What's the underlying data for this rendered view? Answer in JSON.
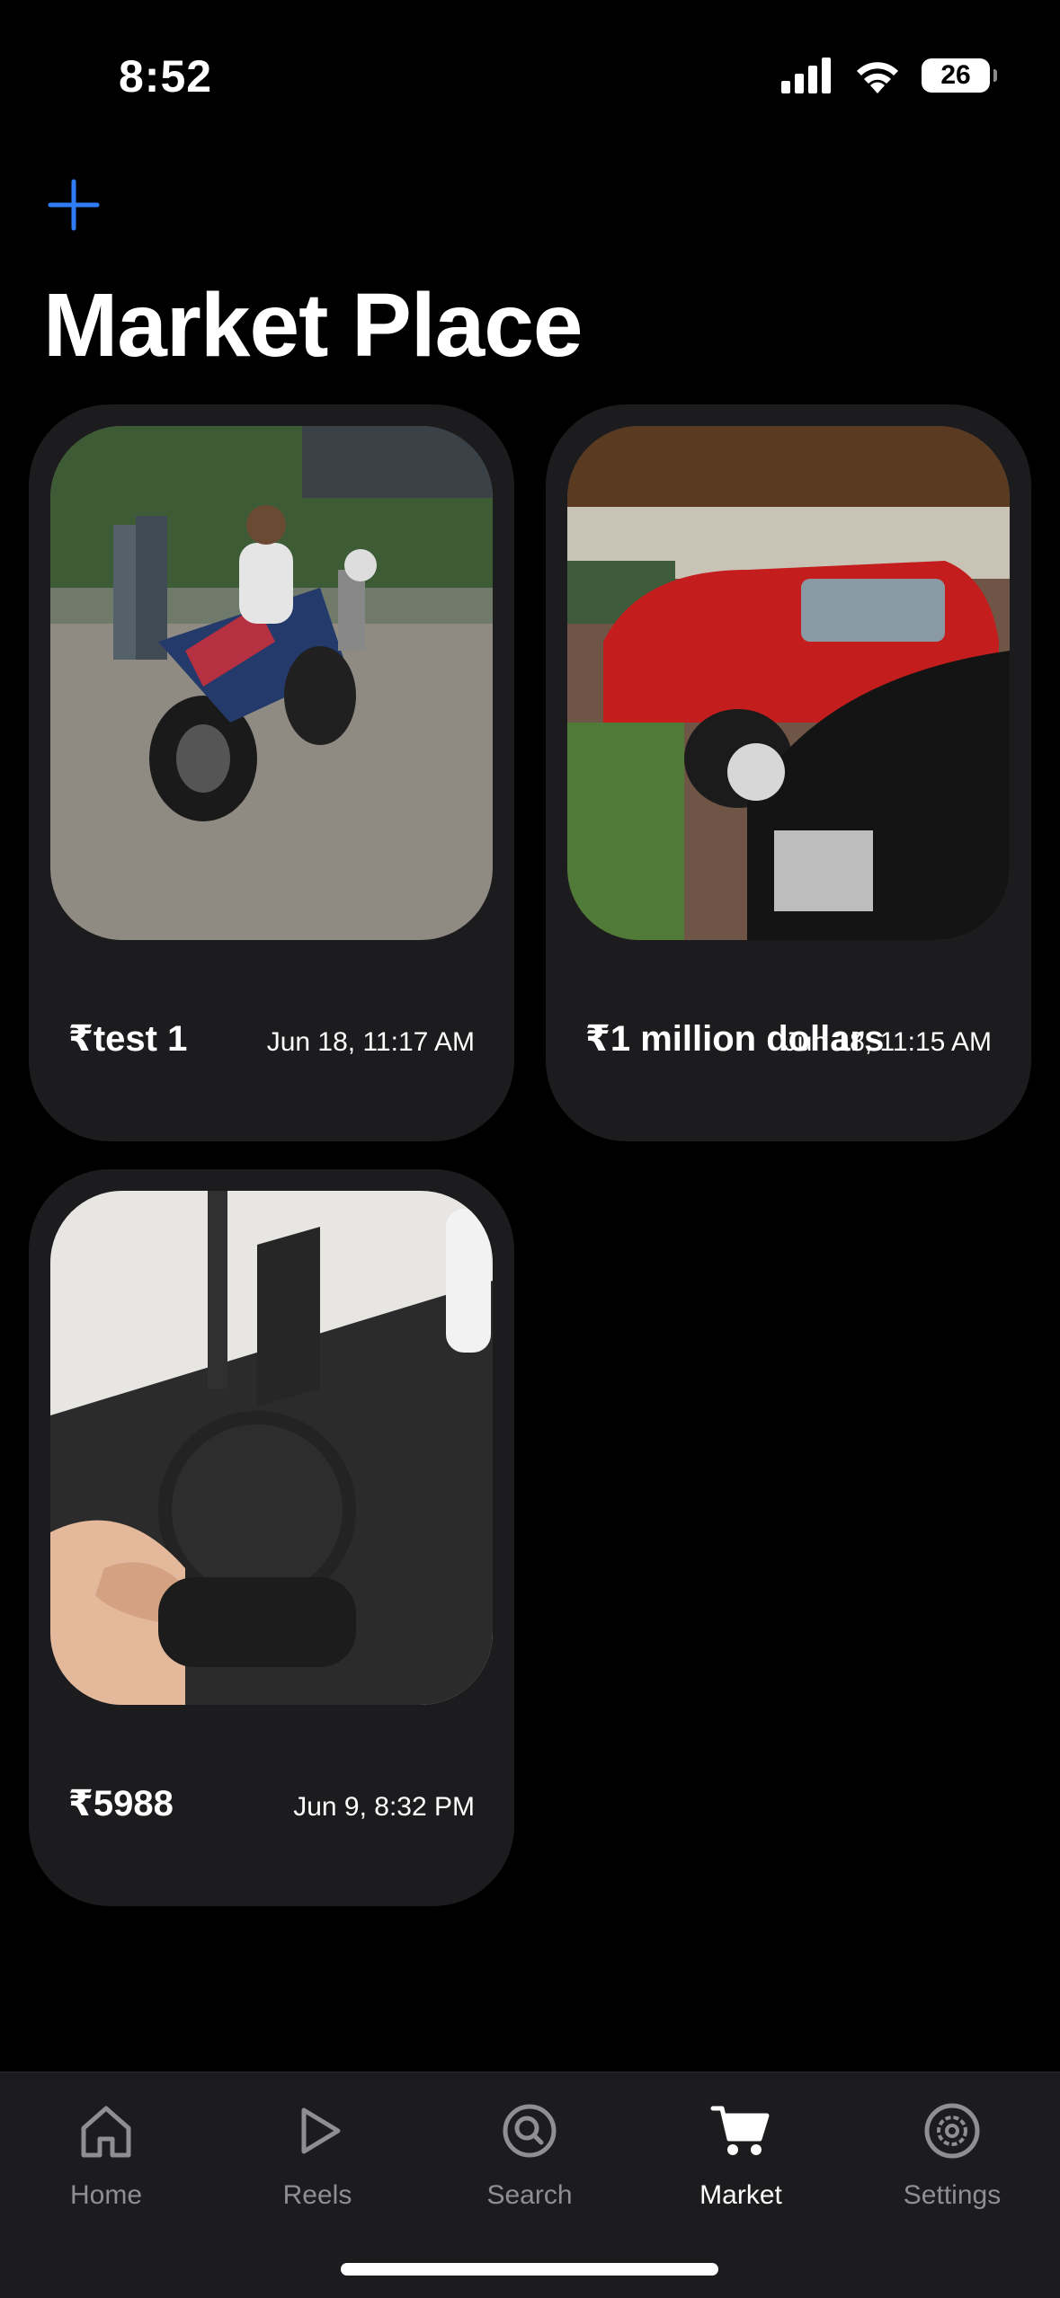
{
  "status_bar": {
    "time": "8:52",
    "battery": "26",
    "icons": [
      "signal-icon",
      "wifi-icon",
      "battery-icon"
    ]
  },
  "header": {
    "add_icon": "plus-icon",
    "title": "Market Place"
  },
  "listings": [
    {
      "price": "₹test 1",
      "date": "Jun 18, 11:17 AM",
      "image": "motorcycle-photo"
    },
    {
      "price": "₹1 million dollars",
      "date": "Jun 18, 11:15 AM",
      "image": "vintage-cars-photo"
    },
    {
      "price": "₹5988",
      "date": "Jun 9, 8:32 PM",
      "image": "headset-photo"
    }
  ],
  "tab_bar": {
    "active": "market",
    "tabs": [
      {
        "id": "home",
        "label": "Home",
        "icon": "house-icon"
      },
      {
        "id": "reels",
        "label": "Reels",
        "icon": "play-icon"
      },
      {
        "id": "search",
        "label": "Search",
        "icon": "search-icon"
      },
      {
        "id": "market",
        "label": "Market",
        "icon": "cart-icon"
      },
      {
        "id": "settings",
        "label": "Settings",
        "icon": "gear-icon"
      }
    ]
  },
  "colors": {
    "accent": "#2f7cf6",
    "background": "#000000",
    "card": "#1c1c1e",
    "inactive": "#8e8e93"
  }
}
